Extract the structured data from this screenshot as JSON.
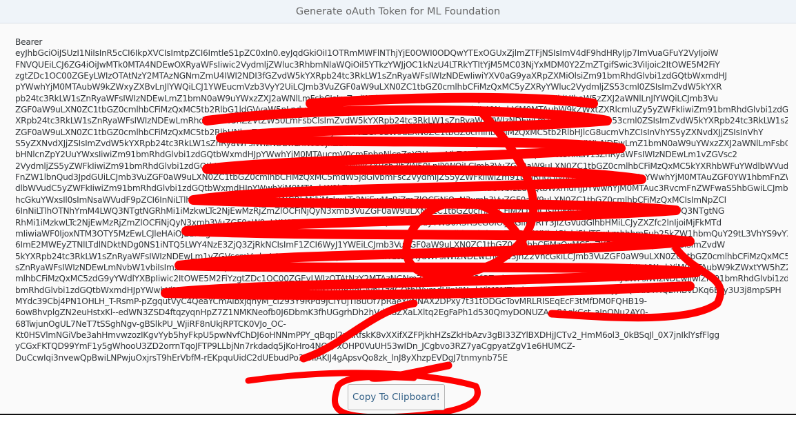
{
  "dialog": {
    "title": "Generate oAuth Token for ML Foundation",
    "token_prefix": "Bearer",
    "token_lines": [
      "eyJhbGciOiJSUzI1NiIsInR5cCI6IkpXVCIsImtpZCI6ImtleS1pZC0xIn0.eyJqdGkiOiI1OTRmMWFlNThjYjE0OWI0ODQwYTExOGUxZjlmZTFjNSIsImV4dF9hdHRyIjp7ImVuaGFuY2VyIjoiW",
      "FNVQUEiLCJ6ZG4iOiJwMTk0MTA4NDEwOXRyaWFsIiwic2VydmljZWluc3RhbmNlaWQiOiI5YTkzYWJjOC1kNzU4LTRkYTItYjM5MC03NjYxMDM0Y2ZmZTgifSwic3ViIjoic2ItOWE5M2FiY",
      "zgtZDc1OC00ZGEyLWIzOTAtNzY2MTAzNGNmZmU4IWI2NDI3fGZvdW5kYXRpb24tc3RkLW1sZnRyaWFsIWIzNDEwIiwiYXV0aG9yaXRpZXMiOlsiZm91bmRhdGlvbi1zdGQtbWxmdHJ",
      "pYWwhYjM0MTAubW9kZWxyZXBvLnJlYWQiLCJ1YWEucmVzb3VyY2UiLCJmb3VuZGF0aW9uLXN0ZC1tbGZ0cmlhbCFiMzQxMC5yZXRyYWluc2VydmljZS53cml0ZSIsImZvdW5kYXR",
      "pb24tc3RkLW1sZnRyaWFsIWIzNDEwLmZ1bmN0aW9uYWxzZXJ2aWNlLmFsbCIsImZvdW5kYXRpb24tc3RkLW1sZnRyaWFsIWIzNDEwLnJldHJhaW5zZXJ2aWNlLnJlYWQiLCJmb3Vu",
      "ZGF0aW9uLXN0ZC1tbGZ0cmlhbCFiMzQxMC5tb2RlbG1ldGVyaW5nLndyaXRlIiwiZm91bmRhdGlvbi1zdGQtbWxmdHJpYWwhYjM0MTAubW9kZWxtZXRlcmluZy5yZWFkIiwiZm91bmRhdGlvbi1zdGQtbW",
      "XRpb24tc3RkLW1sZnRyaWFsIWIzNDEwLmRhdGFtYW5hZ2VtZW50LmFsbCIsImZvdW5kYXRpb24tc3RkLW1sZnRyaWFsIWIzNDEwLm1vZGVscmVwby53cml0ZSIsImZvdW5kYXRpb24tc3RkLW1sZnRyaWFsIWIzNDEwLnN0b3JhZ2VhcGkud3JpdGUiLCJmb3VuZGF0aW9uLXN0ZC1tbGZ0cmlhbCFiMzQxMC5tb2RlbGRlcGxveW1lbnQud3JpdGUiLCJmb3Vu",
      "ZGF0aW9uLXN0ZC1tbGZ0cmlhbCFiMzQxMC5tb2RlbHNlcnZpY2Uud3JpdGUiLCJmb3VuZGF0aW9uLXN0ZC1tbGZ0cmlhbCFiMzQxMC5tb2RlbHJlcG8ucmVhZCIsInVhYS5yZXNvdXJjZSIsInVhY",
      "S5yZXNvdXJjZSIsImZvdW5kYXRpb24tc3RkLW1sZnRyaWFsIWIzNDEwLnN0b3JhZ2VhcGkucmVhZCIsImZvdW5kYXRpb24tc3RkLW1sZnRyaWFsIWIzNDEwLmZ1bmN0aW9uYWxzZXJ2aWNlLmFsbCIsImZvdW5kYXRpb25h",
      "bHNlcnZpY2UuYWxsIiwiZm91bmRhdGlvbi1zdGQtbWxmdHJpYWwhYjM0MTAucmV0cmFpbnNlcnZpY2UucmVhZCIsImZvdW5kYXRpb24tc3RkLW1sZnRyaWFsIWIzNDEwLm1vZGVsc2",
      "2VydmljZS5yZWFkIiwiZm91bmRhdGlvbi1zdGQtbWxmdHJpYWwhYjM0MTAubW9kZWxkZXBsb3ltZW50LnJlYWQiLCJmb3VuZGF0aW9uLXN0ZC1tbGZ0cmlhbCFiMzQxMC5kYXRhbWFuYWdlbWVudC5yZWFkIiwiZm91bmRhdGlvbi1zdGQtbWxmdHJpYWwhYjM0MTAuZGF0YW1hbm",
      "FnZW1lbnQud3JpdGUiLCJmb3VuZGF0aW9uLXN0ZC1tbGZ0cmlhbCFiMzQxMC5mdW5jdGlvbmFsc2VydmljZS5yZWFkIiwiZm91bmRhdGlvbi1zdGQtbWxmdHJpYWwhYjM0MTAuZGF0YW1hbmFnZW1lbnQuYWxsIiwiZm91bmRhdGlvbi1zdGQtbWxmdHJpYWwhYjM0MTAuZGF0YW1hbmFnZW",
      "dlbWVudC5yZWFkIiwiZm91bmRhdGlvbi1zdGQtbWxmdHJpYWwhYjM0MTAubW9kZWxyZXBvLndyaXRlIiwiZm91bmRhdGlvbi1zdGQtbWxmdHJpYWwhYjM0MTAuc3RvcmFnZWFwaS5hbGwiLCJmb3VuZGF0aW9uLXN0ZC1tbGZ0cmlhbCFiMzQxMC5sdG9yYWdlaXN0ZC1tbGZ0cmlhbCFiMzQxMC5zdG9yYWdlY",
      "hcGkuYWxsIl0sImNsaWVudF9pZCI6InNiLTlhOTNhYmM4LWQ3NTgtNGRhMi1iMzkwLTc2NjEwMzRjZmZlOCFiNjQyN3xmb3VuZGF0aW9uLXN0ZC1tbGZ0cmlhbCFiMzQxMCIsImNpZCI",
      "6InNiLTlhOTNhYmM4LWQ3NTgtNGRhMi1iMzkwLTc2NjEwMzRjZmZlOCFiNjQyN3xmb3VuZGF0aW9uLXN0ZC1tbGZ0cmlhbCFiMzQxMCIsImF6cCI6InNiLTlhOTNhYmM4LWQ3NTgtNG",
      "RhMi1iMzkwLTc2NjEwMzRjZmZlOCFiNjQyN3xmb3VuZGF0aW9uLXN0ZC1tbGZ0cmlhbCFiMzQxMCIsImdyYW50X3R5cGUiOiJjbGllbnRfY3JlZGVudGlhbHMiLCJyZXZfc2lnIjoiMjFkMTd",
      "mIiwiaWF0IjoxNTM3OTY5MzEwLCJleHAiOjE1MzgwMTI1MTAsImlzcyI6Imh0dHBzOi8vcDE5NDEwODQxMDl0cmlhbC5hdXRoZW50aWNhdGlvbi5ldTEwLmhhbmEub25kZW1hbmQuY29tL3VhYS9vYXV0aC90b2tlbiIsInppZCI",
      "6ImE2MWEyZTNlLTdlNDktNDg0NS1iNTQ5LWY4NzE3ZjQ3ZjRkNCIsImF1ZCI6WyJ1YWEiLCJmb3VuZGF0aW9uLXN0ZC1tbGZ0cmlhbCFiMzQxMC5yZXRyYWluc2VydmljZSIsImZvdW",
      "5kYXRpb24tc3RkLW1sZnRyaWFsIWIzNDEwLm1vZGVscmVwbyIsImZvdW5kYXRpb24tc3RkLW1sZnRyaWFsIWIzNDEwLnN0b3JhZ2VhcGkiLCJmb3VuZGF0aW9uLXN0ZC1tbGZ0cmlhbCFiMzQxMC5mb3VuZGF0aW9uLXN0ZC1tbGZ0cmlhbCFiMzQxMC5tb2RlbHJlcG8iLCJmb3VuZGF0aW9uLXN0ZC1tbGZ0cmlhbCFiMzQxMC5mdW5jdGlvbmFsIiwiZm91bmRhdGlvbi1zdGQtbW1",
      "sZnRyaWFsIWIzNDEwLmNvbW1vbiIsImZvdW5kYXRpb24tc3RkLW1sZnRyaWFsIWIzNDEwLmRhdGFtYW5hZ2VtZW50IiwiZm91bmRhdGlvbi1zdGQtbWxmdHJpYWwhYjM0MTAubW9kZWxtYW5hZ2VtZW50IiwiZm91bmRhdGlvbi1zdGQtbWxmdHJpYWwhYjM0MTAuZnJhbWVnZW1lbnQiLCJmb3VuZGF0aW9uLXN0ZC1tbGZ0c",
      "mlhbCFiMzQxMC5zdG9yYWdlYXBpIiwic2ItOWE5M2FiYzgtZDc1OC00ZGEyLWIzOTAtNzY2MTAzNGNmZmU4IWI2NDI3fGZvdW5kYXRpb24tc3RkLW1sZnRyaWFsIWIzNDEwIiwiZm91bmRhdGlvbi1zdGQtbWxmdHJpYWwhYjM0MTAucmV0cmFpbnNlcnZpY2UiLCJmb3VuZGF0aW9uLXN0ZC1tbGZ0cmlhbCFiMzQxMC5mb3VuZGF0aW9uLXN0ZC1tbGZ0cmlhbCFiMzQxMC5tb2RlbHNlcnZpY2UiLCJmb3VuZGF0aW9uLXN0ZC1tbGZ0cmlhbCFiMzQxMC5sZXZpY2UiLCJmb3VuZGF0aW9uLXN0ZC1tbGZ0cmlhbCFiMzQxMC5kYXRhIiwiZm91",
      "bmRhdGlvbi1zdGQtbWxmdHJpYWwhYjM0MTAubW9kZWxzZXJ2aWNlIiwiZm91bmRhdGlvbi1zdGQtbWxmdHJpYWwhYjM0MTAubW9kZWxtZXRlcmluZyJdfQ.Ba8YHQ2mBvDKq6Ezy3U3j8mpSPH",
      "MYdc39Cbj4PN1OHLH_T-RsmP-pZgqutVyC4QeaYCmAlbxjqhyM_ci293Y9RPd9JClYUjTl8uOf7pRaeYkNNAX2DPxy7t31tODGcTovMRLRISEqEcF3tMfDM0FQHB19-",
      "6ow8hvplgZN2euHstxKl--edWN3ZSD4ftqzyqnHpZ7Z1NMKNeofb0J6DbmK3fhUGgrhDh2hVdLISZXaLXltq2EgFaPh1d530QmyDONUZAm8AgkCct_aJnQNu2AY0-",
      "68TwjunOgUL7NeT7tSSghNgv-gBSlkPU_WjiRF8nUkjRPTCK0VJo_OC-",
      "Kt0HSVlmNGiVbe3ahHmvwzozIKgvYyb5hyFkpU5pwNvfChDJ6oHNNmPPY_qBqpl2xRRfskK8vXXifXZFPjkhHZsZkHbAzv3gBI33ZYlBXDHjJCTv2_HmM6ol3_0kBSqJl_0X7jnIklYsfFlgg",
      "yCGxFKTQD99YmF1y5gWhooU3ZD2orrnTqoJFTP9LLbjNn7rkdadq5jKoHro4NOQ-xOHP0VuUH53wIDn_JCgbvo3RZ7yaCgpyatZgV1e6HUMCZ-",
      "DuCcwIqi3nvewQpBwiLNPwjuOxjrsT9hErVbfM-rEKpquUidC2dUEbudPo3toIiAKIJ4gApsvQo8zk_lnJ8yXhzpEVDgJ7tnmynb75E"
    ],
    "copy_button_label": "Copy To Clipboard!"
  },
  "colors": {
    "header_bg": "#eff4f9",
    "text": "#32363a",
    "button_text": "#346187",
    "annotation_red": "#ff0000"
  }
}
